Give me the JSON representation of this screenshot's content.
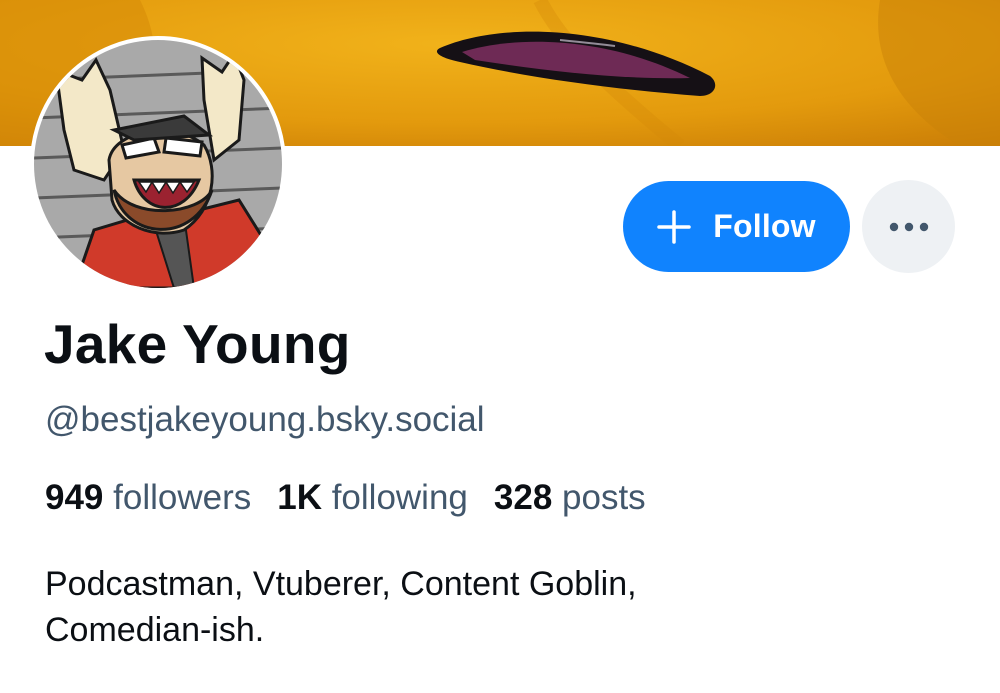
{
  "profile": {
    "display_name": "Jake Young",
    "handle": "@bestjakeyoung.bsky.social",
    "stats": {
      "followers_count": "949",
      "followers_label": "followers",
      "following_count": "1K",
      "following_label": "following",
      "posts_count": "328",
      "posts_label": "posts"
    },
    "bio_line1": "Podcastman, Vtuberer, Content Goblin,",
    "bio_line2": "Comedian-ish."
  },
  "actions": {
    "follow_label": "Follow",
    "follow_icon": "plus-icon",
    "more_icon": "ellipsis-icon"
  },
  "colors": {
    "accent": "#1083fe",
    "more_button_bg": "#eef1f4",
    "text_primary": "#0b0f14",
    "text_secondary": "#42576c",
    "banner": "#e29a0c"
  }
}
